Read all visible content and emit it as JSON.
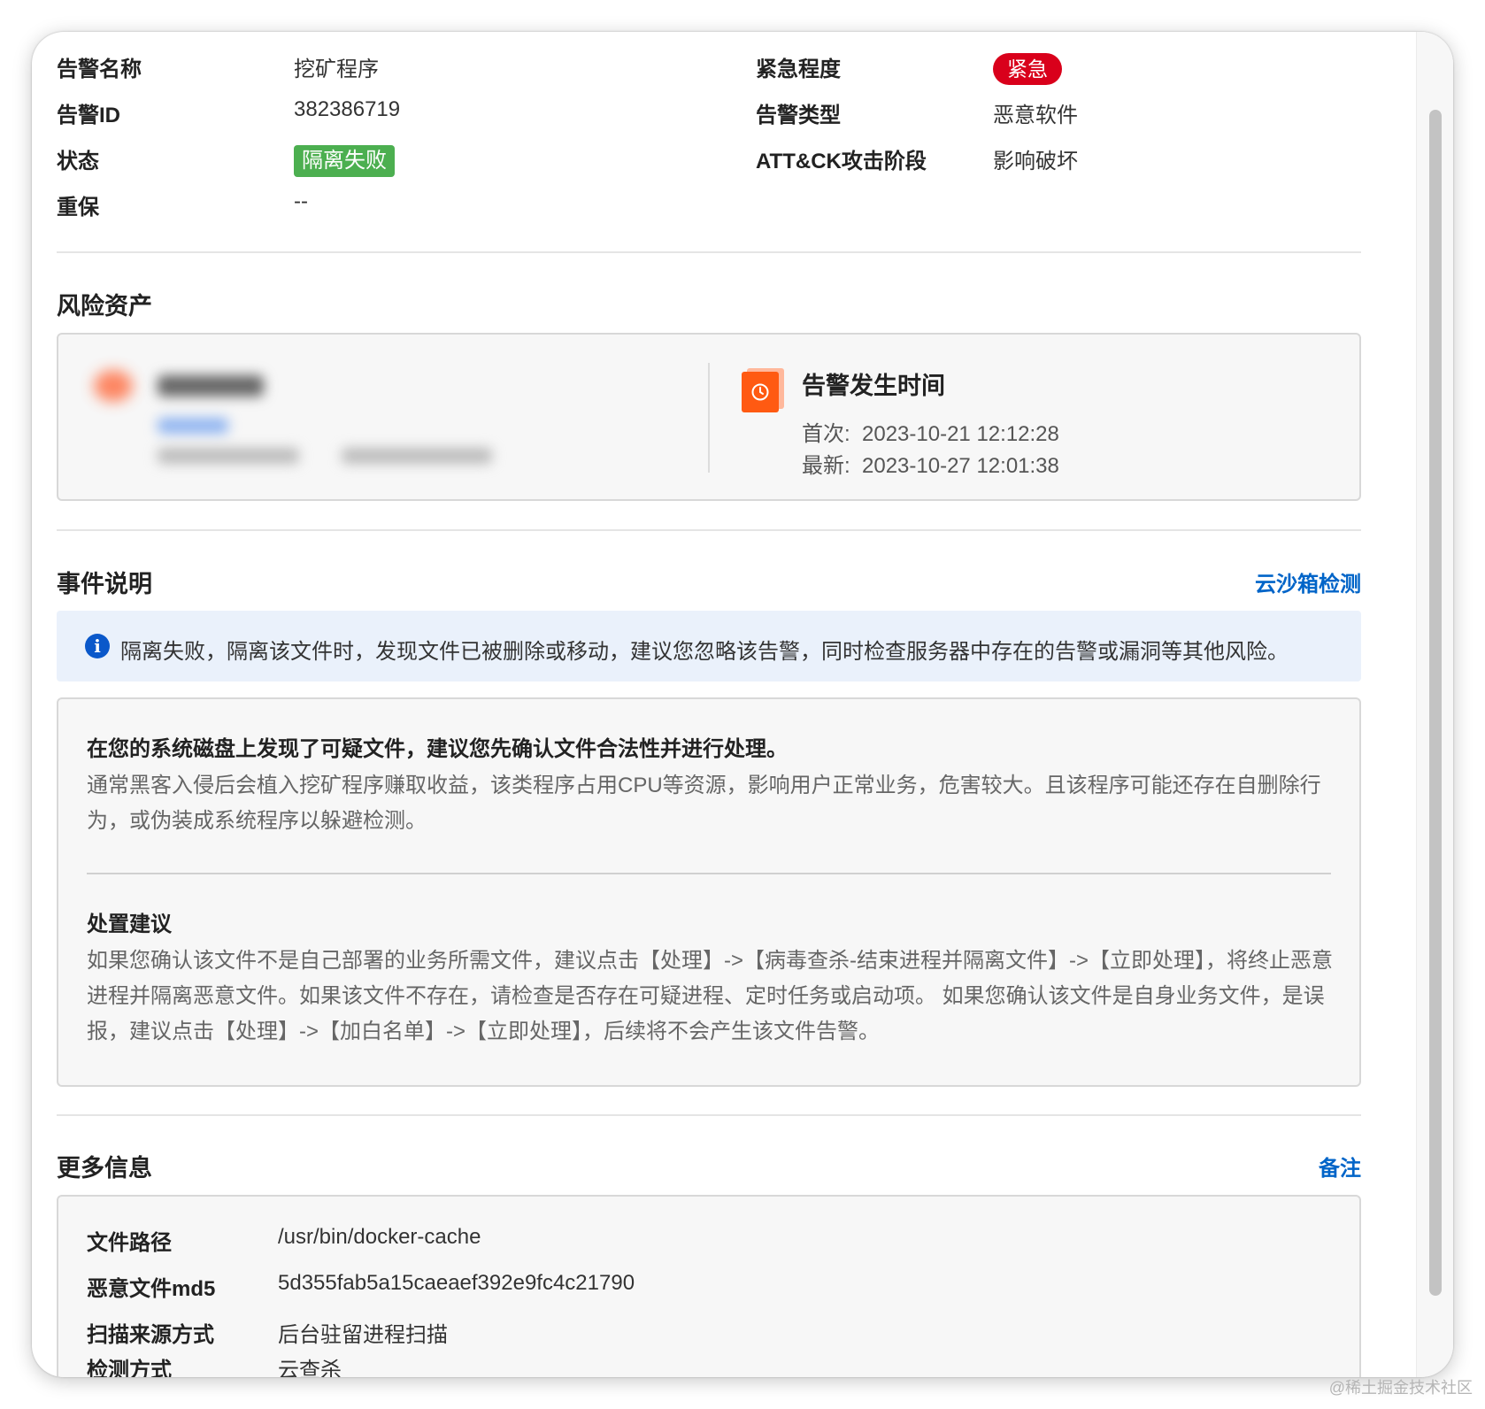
{
  "alert_info": {
    "name_label": "告警名称",
    "name_value": "挖矿程序",
    "id_label": "告警ID",
    "id_value": "382386719",
    "status_label": "状态",
    "status_value": "隔离失败",
    "guard_label": "重保",
    "guard_value": "--",
    "severity_label": "紧急程度",
    "severity_value": "紧急",
    "type_label": "告警类型",
    "type_value": "恶意软件",
    "attck_label": "ATT&CK攻击阶段",
    "attck_value": "影响破坏"
  },
  "risk_assets": {
    "title": "风险资产",
    "time_title": "告警发生时间",
    "first_label": "首次:",
    "first_value": "2023-10-21 12:12:28",
    "latest_label": "最新:",
    "latest_value": "2023-10-27 12:01:38"
  },
  "event": {
    "title": "事件说明",
    "sandbox_link": "云沙箱检测",
    "notice": "隔离失败，隔离该文件时，发现文件已被删除或移动，建议您忽略该告警，同时检查服务器中存在的告警或漏洞等其他风险。",
    "heading": "在您的系统磁盘上发现了可疑文件，建议您先确认文件合法性并进行处理。",
    "body": "通常黑客入侵后会植入挖矿程序赚取收益，该类程序占用CPU等资源，影响用户正常业务，危害较大。且该程序可能还存在自删除行为，或伪装成系统程序以躲避检测。",
    "advice_title": "处置建议",
    "advice_body": "如果您确认该文件不是自己部署的业务所需文件，建议点击【处理】->【病毒查杀-结束进程并隔离文件】->【立即处理】，将终止恶意进程并隔离恶意文件。如果该文件不存在，请检查是否存在可疑进程、定时任务或启动项。 如果您确认该文件是自身业务文件，是误报，建议点击【处理】->【加白名单】->【立即处理】，后续将不会产生该文件告警。"
  },
  "more_info": {
    "title": "更多信息",
    "note_link": "备注",
    "rows": [
      {
        "label": "文件路径",
        "value": "/usr/bin/docker-cache"
      },
      {
        "label": "恶意文件md5",
        "value": "5d355fab5a15caeaef392e9fc4c21790"
      },
      {
        "label": "扫描来源方式",
        "value": "后台驻留进程扫描"
      },
      {
        "label": "检测方式",
        "value": "云查杀"
      }
    ]
  },
  "watermark": "@稀土掘金技术社区",
  "colors": {
    "urgent": "#d9001b",
    "status_fail": "#4caf50",
    "link": "#0064c8",
    "notice_bg": "#eaf1fb",
    "info_icon": "#0a58ca",
    "clock": "#ff5a12"
  },
  "icons": {
    "clock": "clock-icon",
    "info": "info-icon"
  }
}
